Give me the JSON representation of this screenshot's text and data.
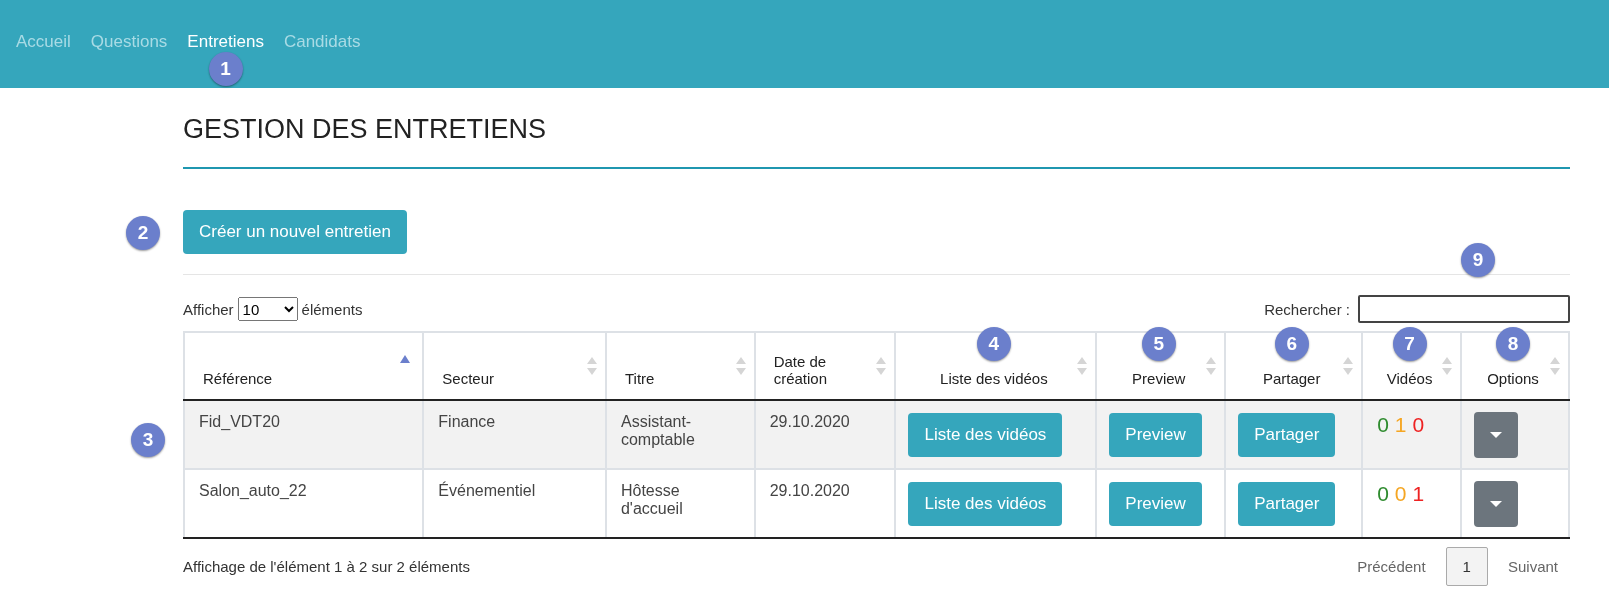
{
  "nav": {
    "items": [
      {
        "label": "Accueil",
        "selected": false
      },
      {
        "label": "Questions",
        "selected": false
      },
      {
        "label": "Entretiens",
        "selected": true,
        "callout": "1"
      },
      {
        "label": "Candidats",
        "selected": false
      }
    ]
  },
  "page": {
    "title": "GESTION DES ENTRETIENS"
  },
  "create_button": {
    "label": "Créer un nouvel entretien",
    "callout": "2"
  },
  "length_control": {
    "prefix": "Afficher",
    "value": "10",
    "suffix": "éléments"
  },
  "search": {
    "label": "Rechercher :",
    "callout": "9"
  },
  "table": {
    "callout": "3",
    "columns": [
      {
        "label": "Référence",
        "sorted": true
      },
      {
        "label": "Secteur",
        "sorted": false
      },
      {
        "label": "Titre",
        "sorted": false
      },
      {
        "label": "Date de création",
        "sorted": false
      },
      {
        "label": "Liste des vidéos",
        "sorted": false,
        "callout": "4"
      },
      {
        "label": "Preview",
        "sorted": false,
        "callout": "5"
      },
      {
        "label": "Partager",
        "sorted": false,
        "callout": "6"
      },
      {
        "label": "Vidéos",
        "sorted": false,
        "callout": "7"
      },
      {
        "label": "Options",
        "sorted": false,
        "callout": "8"
      }
    ],
    "rows": [
      {
        "reference": "Fid_VDT20",
        "secteur": "Finance",
        "titre": "Assistant-comptable",
        "date": "29.10.2020",
        "videos_button": "Liste des vidéos",
        "preview_button": "Preview",
        "share_button": "Partager",
        "counts": [
          {
            "value": "0",
            "color": "#2e8b2e"
          },
          {
            "value": "1",
            "color": "#f5a623"
          },
          {
            "value": "0",
            "color": "#ee2222"
          }
        ]
      },
      {
        "reference": "Salon_auto_22",
        "secteur": "Événementiel",
        "titre": "Hôtesse d'accueil",
        "date": "29.10.2020",
        "videos_button": "Liste des vidéos",
        "preview_button": "Preview",
        "share_button": "Partager",
        "counts": [
          {
            "value": "0",
            "color": "#2e8b2e"
          },
          {
            "value": "0",
            "color": "#f5a623"
          },
          {
            "value": "1",
            "color": "#ee2222"
          }
        ]
      }
    ]
  },
  "info": "Affichage de l'élément 1 à 2 sur 2 éléments",
  "pagination": {
    "previous": "Précédent",
    "pages": [
      {
        "label": "1",
        "selected": true
      }
    ],
    "next": "Suivant"
  }
}
